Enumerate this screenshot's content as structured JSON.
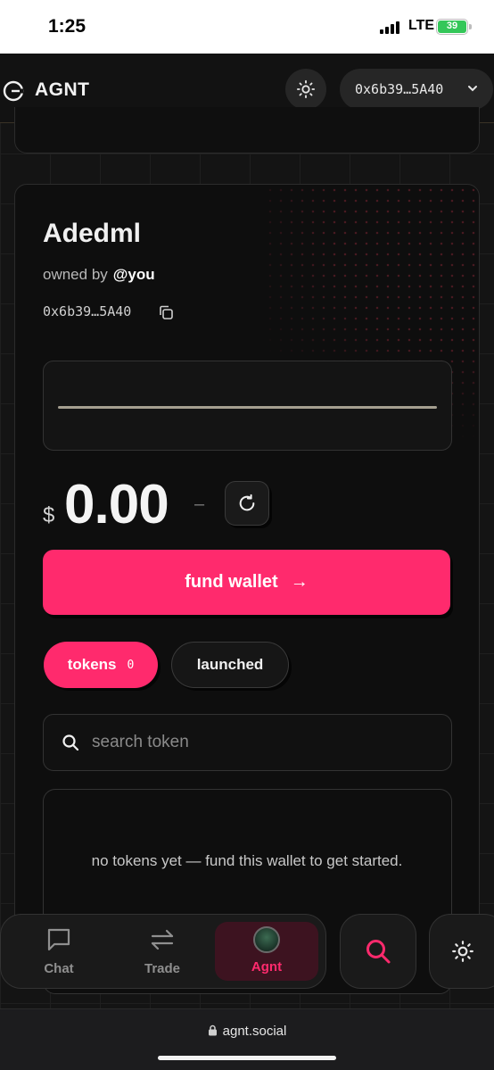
{
  "status_bar": {
    "time": "1:25",
    "network": "LTE",
    "battery": "39"
  },
  "header": {
    "brand": "AGNT",
    "wallet_short": "0x6b39…5A40"
  },
  "agent": {
    "name": "Adedml",
    "owned_by_label": "owned by",
    "owner": "@you",
    "address": "0x6b39…5A40"
  },
  "balance": {
    "currency": "$",
    "amount": "0.00",
    "change": "–"
  },
  "fund_button": {
    "label": "fund wallet",
    "arrow": "→"
  },
  "tabs": [
    {
      "label": "tokens",
      "count": "0",
      "active": true
    },
    {
      "label": "launched",
      "active": false
    }
  ],
  "search": {
    "placeholder": "search token",
    "value": ""
  },
  "empty_state": {
    "message": "no tokens yet — fund this wallet to get started."
  },
  "bottom_nav": {
    "items": [
      {
        "label": "Chat",
        "icon": "chat-bubble-icon"
      },
      {
        "label": "Trade",
        "icon": "swap-arrows-icon"
      },
      {
        "label": "Agnt",
        "icon": "agent-avatar",
        "active": true
      }
    ]
  },
  "browser": {
    "url": "agnt.social"
  },
  "colors": {
    "accent": "#ff2a6d",
    "background": "#111111",
    "surface": "#1a1a1a"
  }
}
